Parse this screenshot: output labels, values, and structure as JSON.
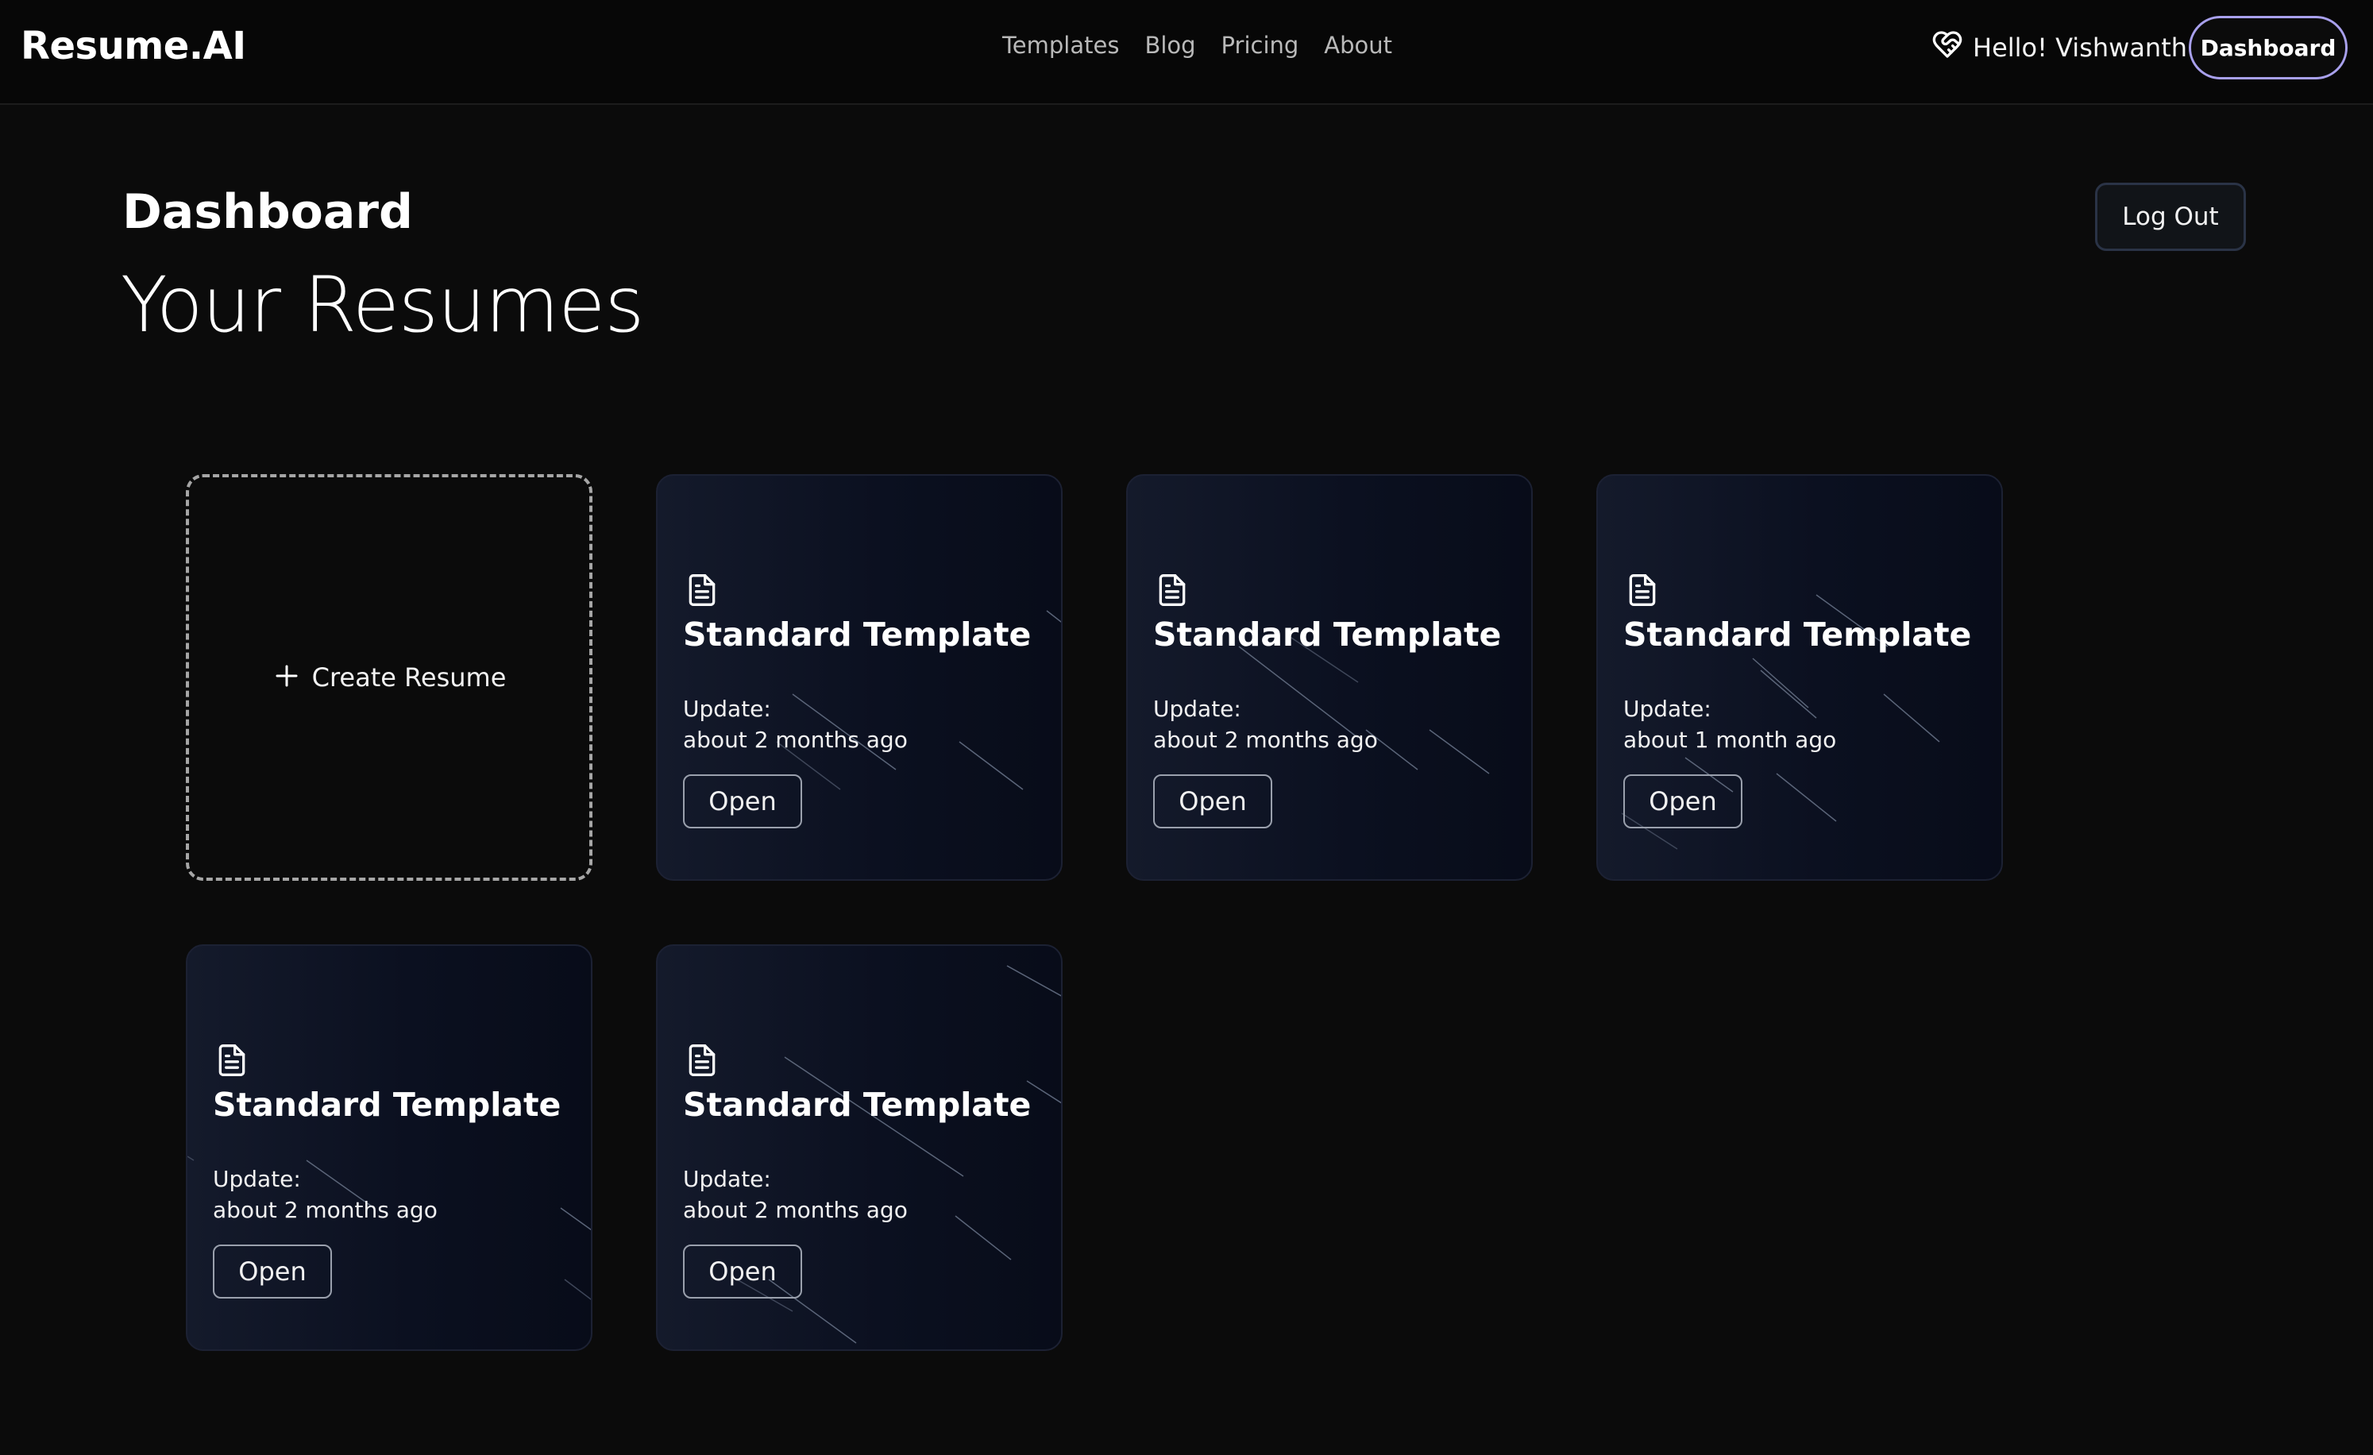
{
  "nav": {
    "logo": "Resume.AI",
    "links": [
      "Templates",
      "Blog",
      "Pricing",
      "About"
    ],
    "greeting": "Hello! Vishwanth",
    "dashboard_button": "Dashboard"
  },
  "page": {
    "heading": "Dashboard",
    "subheading": "Your Resumes",
    "logout_button": "Log Out"
  },
  "create_card": {
    "label": "Create Resume"
  },
  "resumes": [
    {
      "title": "Standard Template",
      "update_label": "Update:",
      "updated": "about 2 months ago",
      "open_label": "Open"
    },
    {
      "title": "Standard Template",
      "update_label": "Update:",
      "updated": "about 2 months ago",
      "open_label": "Open"
    },
    {
      "title": "Standard Template",
      "update_label": "Update:",
      "updated": "about 1 month ago",
      "open_label": "Open"
    },
    {
      "title": "Standard Template",
      "update_label": "Update:",
      "updated": "about 2 months ago",
      "open_label": "Open"
    },
    {
      "title": "Standard Template",
      "update_label": "Update:",
      "updated": "about 2 months ago",
      "open_label": "Open"
    }
  ],
  "icons": {
    "greeting": "heart-handshake-icon",
    "create": "plus-icon",
    "resume": "file-text-icon"
  },
  "colors": {
    "background": "#0b0b0b",
    "navbar": "#070707",
    "card_gradient_start": "#141a2b",
    "card_gradient_end": "#080c19",
    "dashboard_pill_border": "#a8a0ec"
  }
}
